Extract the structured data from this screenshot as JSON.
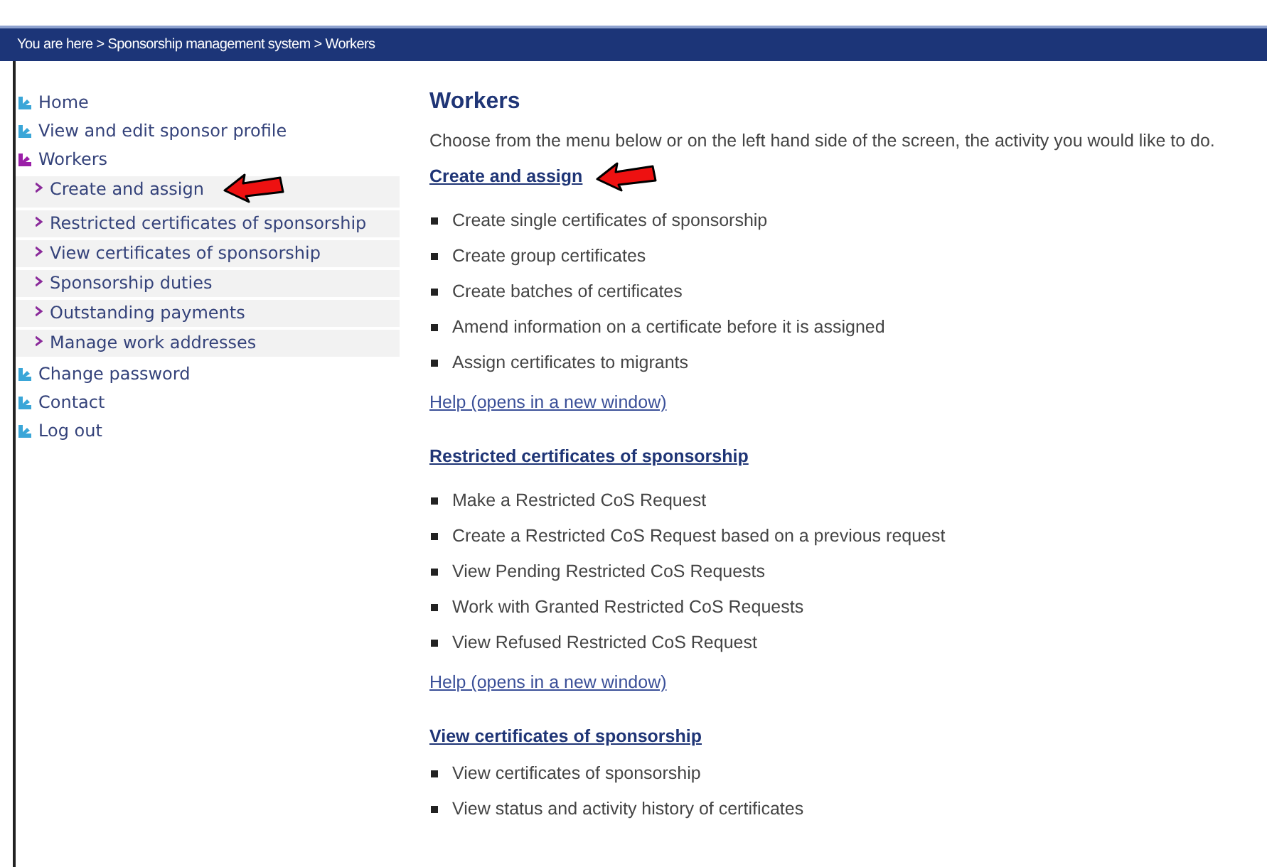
{
  "breadcrumb": "You are here > Sponsorship management system > Workers",
  "sidebar": {
    "items": [
      {
        "label": "Home",
        "selected": false
      },
      {
        "label": "View and edit sponsor profile",
        "selected": false
      },
      {
        "label": "Workers",
        "selected": true,
        "children": [
          {
            "label": "Create and assign",
            "annotated": true
          },
          {
            "label": "Restricted certificates of sponsorship",
            "annotated": false
          },
          {
            "label": "View certificates of sponsorship",
            "annotated": false
          },
          {
            "label": "Sponsorship duties",
            "annotated": false
          },
          {
            "label": "Outstanding payments",
            "annotated": false
          },
          {
            "label": "Manage work addresses",
            "annotated": false
          }
        ]
      },
      {
        "label": "Change password",
        "selected": false
      },
      {
        "label": "Contact",
        "selected": false
      },
      {
        "label": "Log out",
        "selected": false
      }
    ]
  },
  "content": {
    "title": "Workers",
    "intro": "Choose from the menu below or on the left hand side of the screen, the activity you would like to do.",
    "sections": [
      {
        "heading": "Create and assign",
        "annotated": true,
        "items": [
          "Create single certificates of sponsorship",
          "Create group certificates",
          "Create batches of certificates",
          "Amend information on a certificate before it is assigned",
          "Assign certificates to migrants"
        ],
        "help": "Help (opens in a new window)"
      },
      {
        "heading": "Restricted certificates of sponsorship",
        "annotated": false,
        "items": [
          "Make a Restricted CoS Request",
          "Create a Restricted CoS Request based on a previous request",
          "View Pending Restricted CoS Requests",
          "Work with Granted Restricted CoS Requests",
          "View Refused Restricted CoS Request"
        ],
        "help": "Help (opens in a new window)"
      },
      {
        "heading": "View certificates of sponsorship",
        "annotated": false,
        "items": [
          "View certificates of sponsorship",
          "View status and activity history of certificates"
        ]
      }
    ]
  }
}
